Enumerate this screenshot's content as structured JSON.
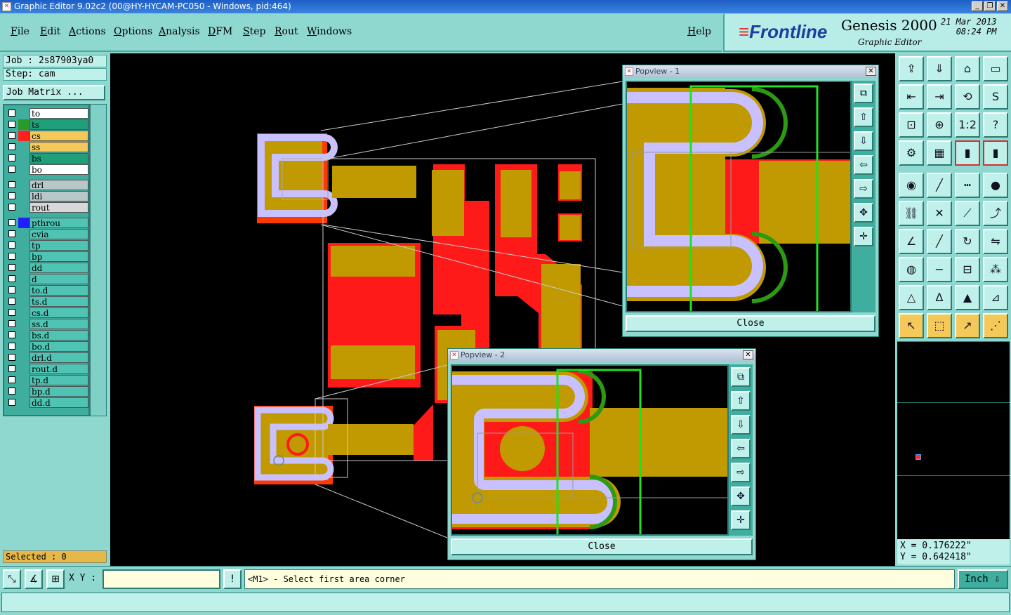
{
  "window": {
    "title": "Graphic Editor 9.02c2 (00@HY-HYCAM-PC050 - Windows, pid:464)"
  },
  "menu": [
    "File",
    "Edit",
    "Actions",
    "Options",
    "Analysis",
    "DFM",
    "Step",
    "Rout",
    "Windows"
  ],
  "help": "Help",
  "branding": {
    "logo": "Frontline",
    "product": "Genesis 2000",
    "subtitle": "Graphic Editor",
    "date": "21 Mar 2013",
    "time": "08:24 PM"
  },
  "job": {
    "job_label": "Job : 2s87903ya0",
    "step_label": "Step: cam",
    "matrix_button": "Job Matrix ..."
  },
  "layers": [
    {
      "name": "to",
      "bg": "#ffffff",
      "mark": ""
    },
    {
      "name": "ts",
      "bg": "#1fa07a",
      "mark": "#2b9a2b"
    },
    {
      "name": "cs",
      "bg": "#f4c95a",
      "mark": "#ff2020"
    },
    {
      "name": "ss",
      "bg": "#f4c95a",
      "mark": ""
    },
    {
      "name": "bs",
      "bg": "#1fa07a",
      "mark": ""
    },
    {
      "name": "bo",
      "bg": "#ffffff",
      "mark": ""
    },
    {
      "name": "drl",
      "bg": "#b8c8c8",
      "mark": ""
    },
    {
      "name": "ldi",
      "bg": "#b8c8c8",
      "mark": ""
    },
    {
      "name": "rout",
      "bg": "#d8d8d8",
      "mark": ""
    },
    {
      "name": "pthrou",
      "bg": "#4fc4b4",
      "mark": "#2020ff"
    },
    {
      "name": "cvia",
      "bg": "#4fc4b4",
      "mark": ""
    },
    {
      "name": "tp",
      "bg": "#4fc4b4",
      "mark": ""
    },
    {
      "name": "bp",
      "bg": "#4fc4b4",
      "mark": ""
    },
    {
      "name": "dd",
      "bg": "#4fc4b4",
      "mark": ""
    },
    {
      "name": "d",
      "bg": "#4fc4b4",
      "mark": ""
    },
    {
      "name": "to.d",
      "bg": "#4fc4b4",
      "mark": ""
    },
    {
      "name": "ts.d",
      "bg": "#4fc4b4",
      "mark": ""
    },
    {
      "name": "cs.d",
      "bg": "#4fc4b4",
      "mark": ""
    },
    {
      "name": "ss.d",
      "bg": "#4fc4b4",
      "mark": ""
    },
    {
      "name": "bs.d",
      "bg": "#4fc4b4",
      "mark": ""
    },
    {
      "name": "bo.d",
      "bg": "#4fc4b4",
      "mark": ""
    },
    {
      "name": "drl.d",
      "bg": "#4fc4b4",
      "mark": ""
    },
    {
      "name": "rout.d",
      "bg": "#4fc4b4",
      "mark": ""
    },
    {
      "name": "tp.d",
      "bg": "#4fc4b4",
      "mark": ""
    },
    {
      "name": "bp.d",
      "bg": "#4fc4b4",
      "mark": ""
    },
    {
      "name": "dd.d",
      "bg": "#4fc4b4",
      "mark": ""
    }
  ],
  "selected": "Selected : 0",
  "popviews": [
    {
      "title": "Popview - 1",
      "close": "Close"
    },
    {
      "title": "Popview - 2",
      "close": "Close"
    }
  ],
  "coords": {
    "x": "X = 0.176222\"",
    "y": "Y = 0.642418\""
  },
  "status": {
    "xy_label": "X Y :",
    "xy_value": "",
    "prompt": "<M1> - Select first area corner",
    "unit": "Inch"
  },
  "colors": {
    "copper": "#c09a00",
    "mask": "#ff1a1a",
    "silk": "#c8c0ff",
    "green": "#2c9a12",
    "highlight": "#22e022"
  }
}
